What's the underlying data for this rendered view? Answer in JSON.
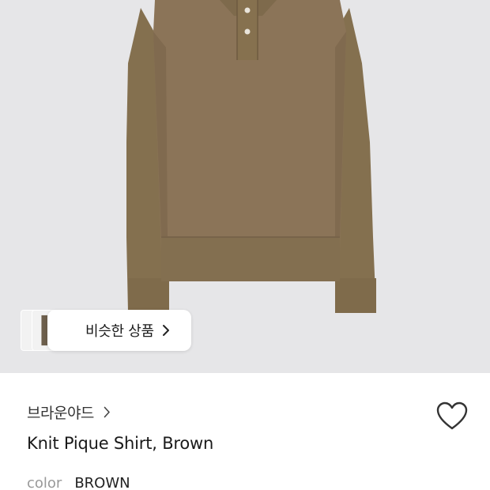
{
  "image": {
    "name": "brown knit pique shirt"
  },
  "similar": {
    "label": "비슷한 상품"
  },
  "product": {
    "brand": "브라운야드",
    "title": "Knit Pique Shirt, Brown",
    "color_label": "color",
    "color_value": "BROWN"
  },
  "colors": {
    "background": "#e6e6e8",
    "garment": "#8b7458",
    "garment_shadow": "#7a6449",
    "muted_text": "#999999"
  },
  "icons": {
    "similar_chevron": "chevron-right-icon",
    "brand_chevron": "chevron-right-icon",
    "wishlist": "heart-outline-icon"
  }
}
